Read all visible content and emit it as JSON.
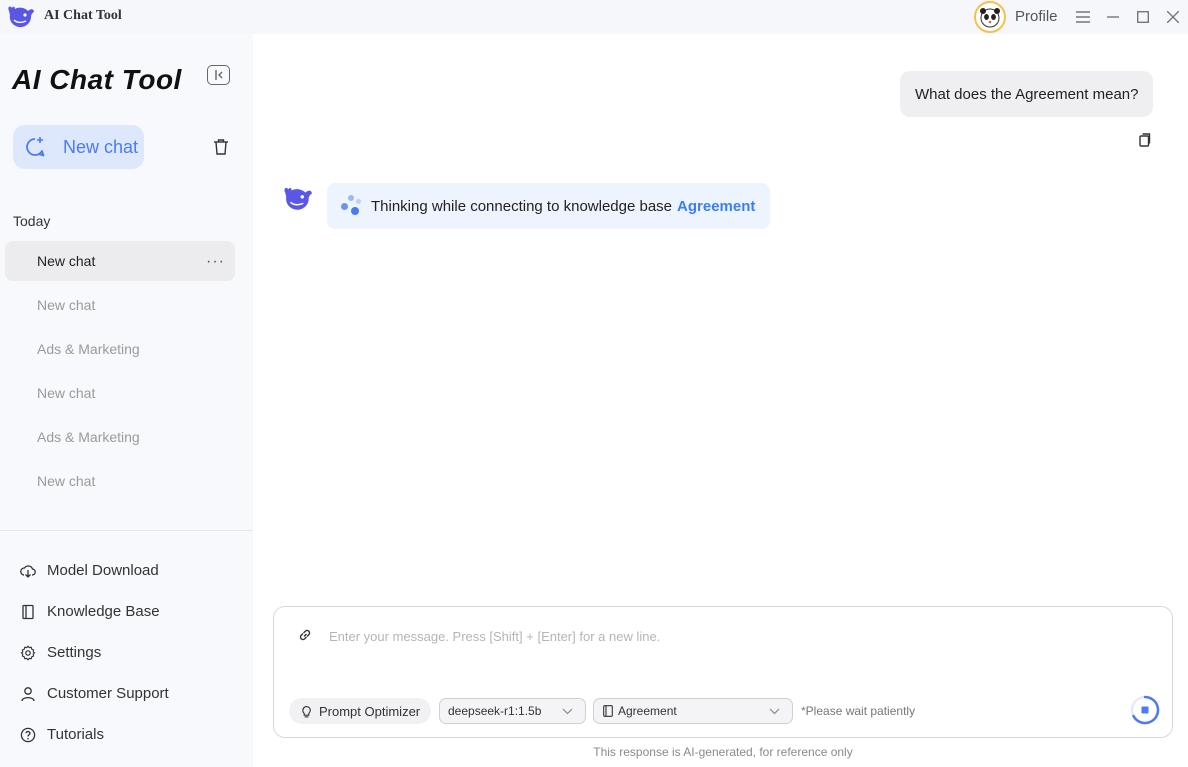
{
  "titlebar": {
    "app_name": "AI Chat Tool",
    "profile_label": "Profile",
    "icons": [
      "whale-logo-icon",
      "panda-avatar-icon",
      "menu-icon",
      "minimize-icon",
      "maximize-icon",
      "close-icon"
    ]
  },
  "sidebar": {
    "brand": "AI Chat Tool",
    "new_chat_label": "New chat",
    "section_today": "Today",
    "chats": [
      {
        "label": "New chat",
        "active": true
      },
      {
        "label": "New chat",
        "active": false
      },
      {
        "label": "Ads & Marketing",
        "active": false
      },
      {
        "label": "New chat",
        "active": false
      },
      {
        "label": "Ads & Marketing",
        "active": false
      },
      {
        "label": "New chat",
        "active": false
      }
    ],
    "more_label": "···",
    "nav": [
      {
        "label": "Model Download",
        "icon": "cloud-download-icon"
      },
      {
        "label": "Knowledge Base",
        "icon": "book-icon"
      },
      {
        "label": "Settings",
        "icon": "gear-icon"
      },
      {
        "label": "Customer Support",
        "icon": "person-icon"
      },
      {
        "label": "Tutorials",
        "icon": "question-icon"
      }
    ]
  },
  "conversation": {
    "user_message": "What does the Agreement mean?",
    "bot_status_text": "Thinking while connecting to knowledge base",
    "bot_status_kb": "Agreement"
  },
  "composer": {
    "placeholder": "Enter your message. Press [Shift] + [Enter] for a new line.",
    "value": "",
    "prompt_optimizer_label": "Prompt Optimizer",
    "model_selected": "deepseek-r1:1.5b",
    "kb_selected": "Agreement",
    "wait_note": "*Please wait patiently"
  },
  "footer": {
    "disclaimer": "This response is AI-generated, for reference only"
  },
  "colors": {
    "accent": "#4a7bf0",
    "link_blue": "#3b7ff0",
    "sidebar_bg": "#f8f9fc",
    "new_chat_bg": "#dde8fc"
  }
}
